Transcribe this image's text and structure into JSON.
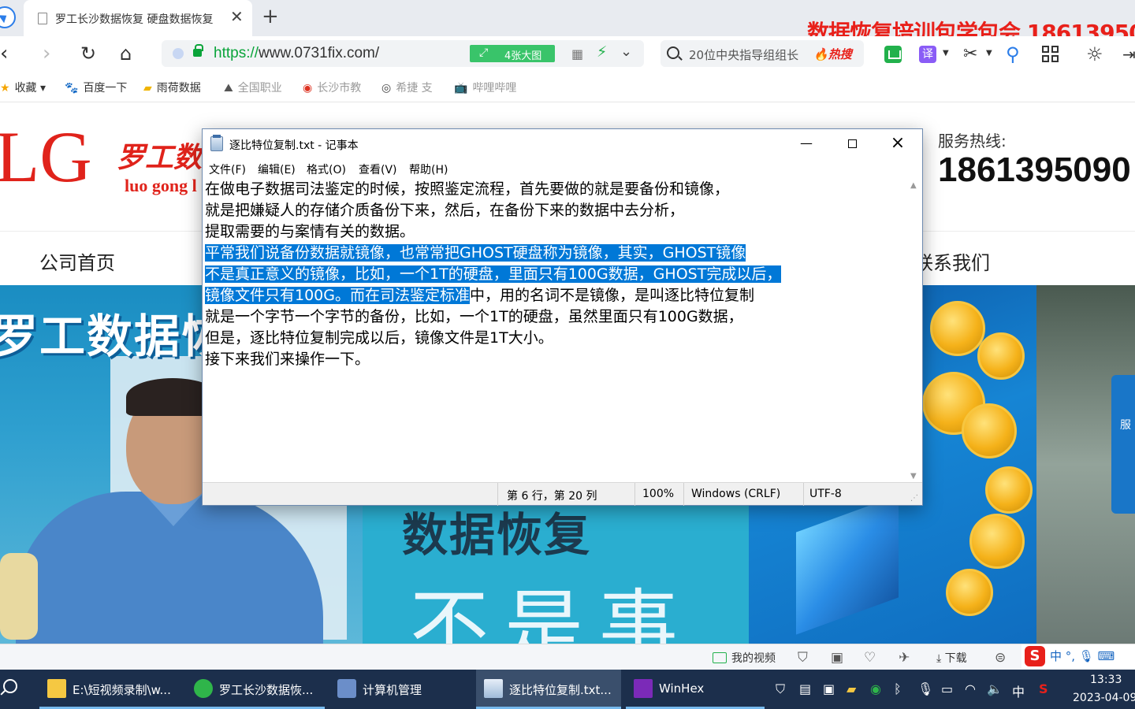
{
  "browser": {
    "tab_title": "罗工长沙数据恢复 硬盘数据恢复",
    "promo_text": "数据恢复培训包学包会 18613950",
    "url_scheme": "https://",
    "url_rest": "www.0731fix.com/",
    "bigpic_label": "4张大图",
    "search_text": "20位中央指导组组长",
    "hot_label": "热搜",
    "translate_label": "译",
    "bookmarks": [
      "收藏",
      "百度一下",
      "雨荷数据",
      "全国职业",
      "长沙市教",
      "希捷 支",
      "哔哩哔哩"
    ]
  },
  "site": {
    "logo_letters": "LG",
    "logo_cn": "罗工数",
    "logo_en": "luo gong l",
    "hotline_label": "服务热线:",
    "hotline_number": "1861395090",
    "nav_home": "公司首页",
    "nav_contact": "联系我们",
    "banner_title": "罗工数据恢",
    "banner_heading": "数据恢复",
    "banner_slogan": "不是事",
    "float_label": "服"
  },
  "notepad": {
    "title": "逐比特位复制.txt - 记事本",
    "menus": [
      "文件(F)",
      "编辑(E)",
      "格式(O)",
      "查看(V)",
      "帮助(H)"
    ],
    "lines": [
      {
        "plain": "在做电子数据司法鉴定的时候，按照鉴定流程，首先要做的就是要备份和镜像，",
        "sel": "",
        "after": ""
      },
      {
        "plain": "就是把嫌疑人的存储介质备份下来，然后，在备份下来的数据中去分析，",
        "sel": "",
        "after": ""
      },
      {
        "plain": "提取需要的与案情有关的数据。",
        "sel": "",
        "after": ""
      },
      {
        "plain": "",
        "sel": "平常我们说备份数据就镜像，也常常把GHOST硬盘称为镜像，其实，GHOST镜像",
        "after": ""
      },
      {
        "plain": "",
        "sel": "不是真正意义的镜像，比如，一个1T的硬盘，里面只有100G数据，GHOST完成以后，",
        "after": ""
      },
      {
        "plain": "",
        "sel": "镜像文件只有100G。而在司法鉴定标准",
        "after": "中，用的名词不是镜像，是叫逐比特位复制"
      },
      {
        "plain": "就是一个字节一个字节的备份，比如，一个1T的硬盘，虽然里面只有100G数据，",
        "sel": "",
        "after": ""
      },
      {
        "plain": "但是，逐比特位复制完成以后，镜像文件是1T大小。",
        "sel": "",
        "after": ""
      },
      {
        "plain": "接下来我们来操作一下。",
        "sel": "",
        "after": ""
      }
    ],
    "status": {
      "position": "第 6 行，第 20 列",
      "zoom": "100%",
      "line_ending": "Windows (CRLF)",
      "encoding": "UTF-8"
    }
  },
  "browser_status": {
    "my_video": "我的视频",
    "download": "下载",
    "ime_text": "中 °, 🎙 ⌨"
  },
  "taskbar": {
    "items": [
      {
        "label": "E:\\短视频录制\\w...",
        "icon": "folder-icon"
      },
      {
        "label": "罗工长沙数据恢...",
        "icon": "browser-icon"
      },
      {
        "label": "计算机管理",
        "icon": "computer-management-icon"
      },
      {
        "label": "逐比特位复制.txt...",
        "icon": "notepad-icon"
      },
      {
        "label": "WinHex",
        "icon": "winhex-icon"
      }
    ],
    "tray_lang": "中",
    "time": "13:33",
    "date": "2023-04-09"
  }
}
